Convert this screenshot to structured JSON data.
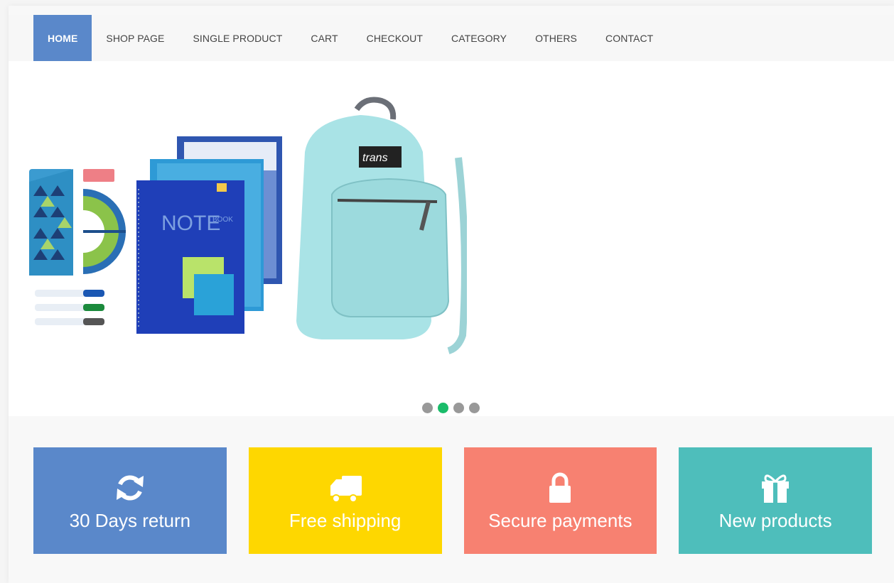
{
  "nav": {
    "items": [
      {
        "label": "HOME",
        "active": true
      },
      {
        "label": "SHOP PAGE"
      },
      {
        "label": "SINGLE PRODUCT"
      },
      {
        "label": "CART"
      },
      {
        "label": "CHECKOUT"
      },
      {
        "label": "CATEGORY"
      },
      {
        "label": "OTHERS"
      },
      {
        "label": "CONTACT"
      }
    ]
  },
  "slider": {
    "backpack_brand": "trans",
    "notebook_title": "NOTE",
    "notebook_sub": "BOOK",
    "active_dot": 1,
    "dot_count": 4
  },
  "promos": [
    {
      "label": "30 Days return",
      "icon": "refresh-icon",
      "color": "#5a88ca"
    },
    {
      "label": "Free shipping",
      "icon": "truck-icon",
      "color": "#fed700"
    },
    {
      "label": "Secure payments",
      "icon": "lock-icon",
      "color": "#f78171"
    },
    {
      "label": "New products",
      "icon": "gift-icon",
      "color": "#4ebebb"
    }
  ]
}
